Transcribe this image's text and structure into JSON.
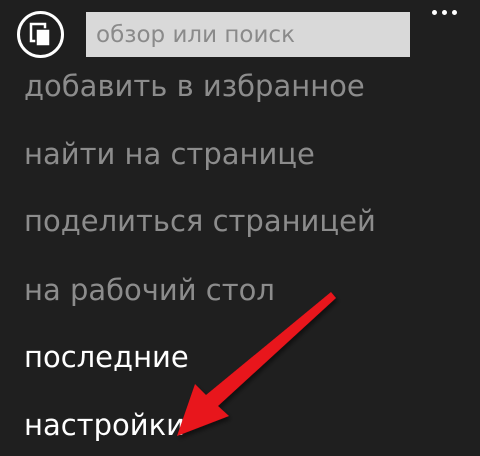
{
  "app_bar": {
    "tabs_icon": "tabs-icon",
    "address_placeholder": "обзор или поиск",
    "more_icon": "more-dots-icon"
  },
  "menu": {
    "items": [
      {
        "label": "добавить в избранное",
        "enabled": false
      },
      {
        "label": "найти на странице",
        "enabled": false
      },
      {
        "label": "поделиться страницей",
        "enabled": false
      },
      {
        "label": "на рабочий стол",
        "enabled": false
      },
      {
        "label": "последние",
        "enabled": true
      },
      {
        "label": "настройки",
        "enabled": true
      }
    ]
  },
  "annotation": {
    "arrow_color": "#e8121a",
    "points_to": "настройки"
  },
  "colors": {
    "background": "#1f1f1f",
    "disabled_text": "#8c8c8c",
    "enabled_text": "#ffffff",
    "address_bar": "#d9d9d9"
  }
}
